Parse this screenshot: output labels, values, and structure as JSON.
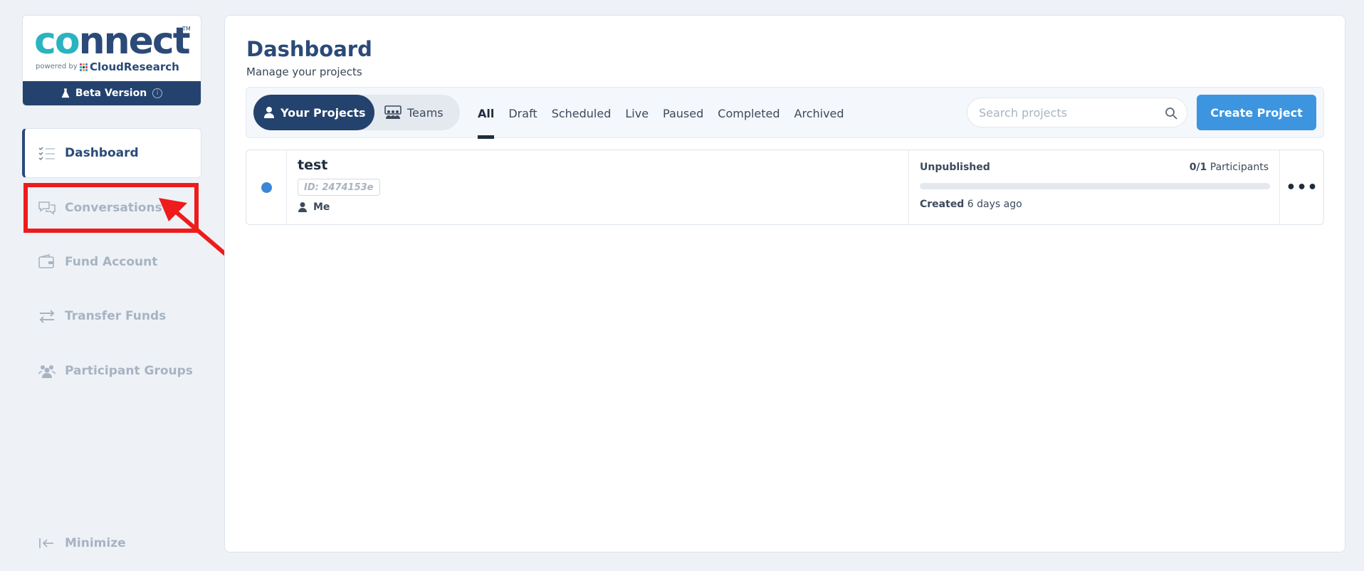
{
  "brand": {
    "logo_text": "connect",
    "trademark": "TM",
    "powered_by": "powered by",
    "company": "CloudResearch",
    "beta_label": "Beta Version",
    "info_symbol": "i"
  },
  "sidebar": {
    "items": [
      {
        "label": "Dashboard",
        "icon": "list-check-icon",
        "active": true
      },
      {
        "label": "Conversations",
        "icon": "chat-bubbles-icon",
        "active": false
      },
      {
        "label": "Fund Account",
        "icon": "wallet-icon",
        "active": false
      },
      {
        "label": "Transfer Funds",
        "icon": "transfer-arrows-icon",
        "active": false
      },
      {
        "label": "Participant Groups",
        "icon": "users-icon",
        "active": false
      }
    ],
    "minimize_label": "Minimize"
  },
  "annotation": {
    "color": "#ee1c1c",
    "target": "Conversations"
  },
  "header": {
    "title": "Dashboard",
    "subtitle": "Manage your projects"
  },
  "toolbar": {
    "scope": [
      {
        "label": "Your Projects",
        "icon": "person-icon",
        "selected": true
      },
      {
        "label": "Teams",
        "icon": "team-icon",
        "selected": false
      }
    ],
    "tabs": [
      {
        "label": "All",
        "selected": true
      },
      {
        "label": "Draft",
        "selected": false
      },
      {
        "label": "Scheduled",
        "selected": false
      },
      {
        "label": "Live",
        "selected": false
      },
      {
        "label": "Paused",
        "selected": false
      },
      {
        "label": "Completed",
        "selected": false
      },
      {
        "label": "Archived",
        "selected": false
      }
    ],
    "search_placeholder": "Search projects",
    "create_label": "Create Project"
  },
  "projects": [
    {
      "name": "test",
      "id_label": "ID: 2474153e",
      "owner": "Me",
      "status": "Unpublished",
      "participants_count": "0/1",
      "participants_label": "Participants",
      "progress": 0,
      "created_label": "Created",
      "created_value": "6 days ago",
      "status_color": "#3d85d6",
      "more_symbol": "•••"
    }
  ],
  "colors": {
    "primary": "#24426e",
    "accent": "#3d95e0",
    "muted": "#a8b3c2"
  }
}
